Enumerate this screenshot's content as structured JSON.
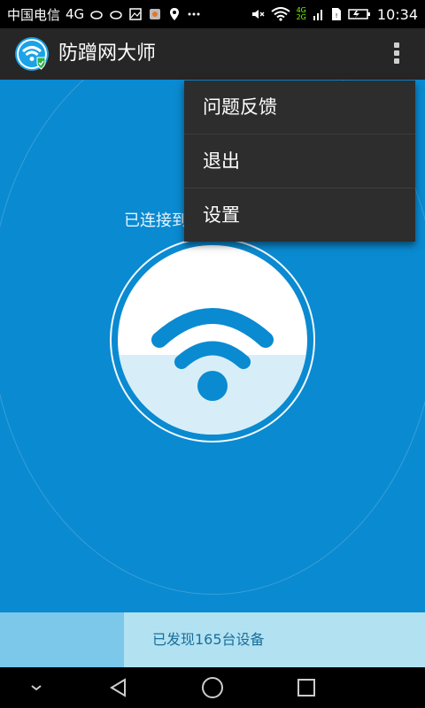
{
  "status_bar": {
    "carrier": "中国电信",
    "network": "4G",
    "time": "10:34",
    "net_top": "4G",
    "net_bottom": "2G"
  },
  "app_bar": {
    "title": "防蹭网大师",
    "logo_icon": "wifi-shield-icon",
    "overflow_icon": "more-vert-icon"
  },
  "menu": {
    "items": [
      {
        "label": "问题反馈"
      },
      {
        "label": "退出"
      },
      {
        "label": "设置"
      }
    ]
  },
  "main": {
    "connected_text": "已连接到",
    "wifi_icon": "wifi-icon",
    "level": 0.42
  },
  "info_bar": {
    "devices_text": "已发现165台设备"
  },
  "colors": {
    "accent": "#0a8ad1",
    "menu_bg": "#2d2d2d",
    "appbar_bg": "#262626",
    "info_bg": "#b2e2f2"
  }
}
